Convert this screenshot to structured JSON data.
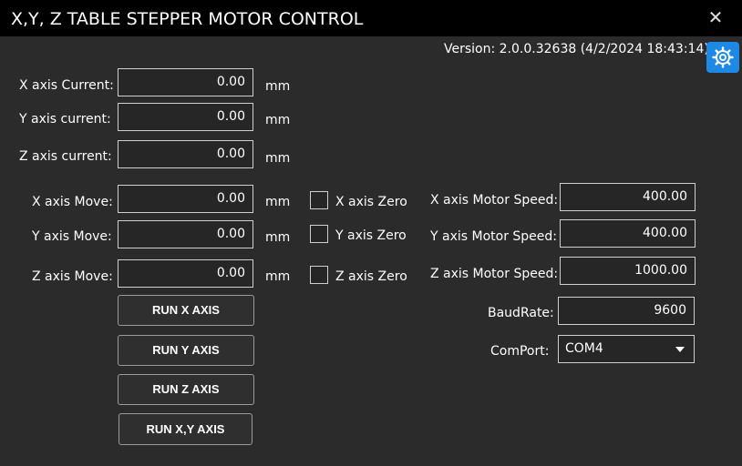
{
  "window": {
    "title": "X,Y, Z TABLE STEPPER MOTOR CONTROL",
    "close_symbol": "✕"
  },
  "version": "Version: 2.0.0.32638 (4/2/2024 18:43:14)",
  "accent_color": "#1e88e5",
  "labels": {
    "x_current": "X axis Current:",
    "y_current": "Y axis current:",
    "z_current": "Z axis current:",
    "x_move": "X axis Move:",
    "y_move": "Y axis Move:",
    "z_move": "Z axis Move:",
    "x_zero": "X axis Zero",
    "y_zero": "Y axis Zero",
    "z_zero": "Z axis Zero",
    "x_speed": "X axis Motor Speed:",
    "y_speed": "Y axis Motor Speed:",
    "z_speed": "Z axis Motor Speed:",
    "baud": "BaudRate:",
    "comport": "ComPort:"
  },
  "unit": "mm",
  "values": {
    "x_current": "0.00",
    "y_current": "0.00",
    "z_current": "0.00",
    "x_move": "0.00",
    "y_move": "0.00",
    "z_move": "0.00",
    "x_speed": "400.00",
    "y_speed": "400.00",
    "z_speed": "1000.00",
    "baud": "9600",
    "comport": "COM4"
  },
  "buttons": {
    "run_x": "RUN X AXIS",
    "run_y": "RUN Y AXIS",
    "run_z": "RUN Z AXIS",
    "run_xy": "RUN X,Y AXIS"
  },
  "icons": {
    "settings": "gear-icon",
    "dropdown": "chevron-down-icon"
  }
}
